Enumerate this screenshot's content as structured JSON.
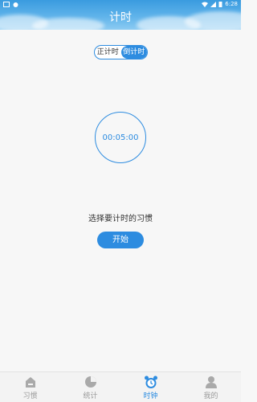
{
  "statusbar": {
    "time": "6:28"
  },
  "header": {
    "title": "计时"
  },
  "mode_toggle": {
    "options": [
      {
        "label": "正计时",
        "active": false
      },
      {
        "label": "倒计时",
        "active": true
      }
    ]
  },
  "timer": {
    "display": "00:05:00"
  },
  "prompt": {
    "text": "选择要计时的习惯"
  },
  "start_button": {
    "label": "开始"
  },
  "tabbar": {
    "items": [
      {
        "label": "习惯",
        "icon": "home-icon",
        "active": false
      },
      {
        "label": "统计",
        "icon": "pie-chart-icon",
        "active": false
      },
      {
        "label": "时钟",
        "icon": "alarm-clock-icon",
        "active": true
      },
      {
        "label": "我的",
        "icon": "person-icon",
        "active": false
      }
    ]
  },
  "colors": {
    "accent": "#2d8ce0",
    "inactive": "#9a9a9a",
    "background": "#f7f7f7"
  }
}
